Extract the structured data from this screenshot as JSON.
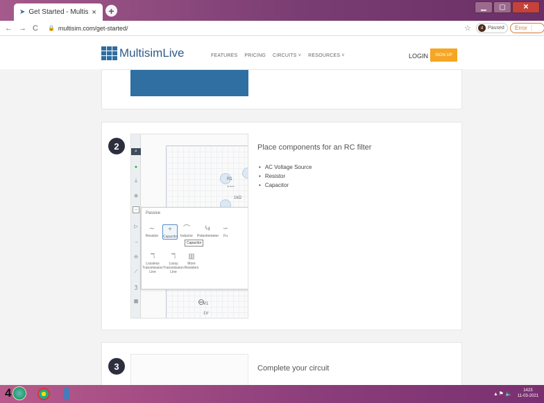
{
  "browser": {
    "tab_title": "Get Started - Multisim Liv",
    "tab_close": "×",
    "new_tab": "+",
    "nav_back": "←",
    "nav_forward": "→",
    "nav_reload": "C",
    "url": "multisim.com/get-started/",
    "profile_initial": "d",
    "profile_status": "Paused",
    "error_label": "Error"
  },
  "site": {
    "logo_text": "MultisimLive",
    "menu": [
      "FEATURES",
      "PRICING",
      "CIRCUITS ˅",
      "RESOURCES ˅"
    ],
    "login": "LOGIN",
    "signup": "SIGN UP"
  },
  "steps": [
    {
      "number": "2",
      "title": "Place components for an RC filter",
      "bullets": [
        "AC Voltage Source",
        "Resistor",
        "Capacitor"
      ]
    },
    {
      "number": "3",
      "title": "Complete your circuit"
    }
  ],
  "editor": {
    "r1_label": "R1",
    "r1_value": "1kΩ",
    "panel_title": "Passive",
    "tooltip": "Capacitor",
    "items": [
      "Resistor",
      "Capacitor",
      "Inductor",
      "Potentiometer",
      "Fu"
    ],
    "items2": [
      "Lossless Transmission Line",
      "Lossy Transmission Line",
      "More Resistors"
    ],
    "v1_label": "V1",
    "v1_value": "1V"
  },
  "taskbar": {
    "left_text": "4",
    "time": "1423",
    "date": "11-03-2021"
  }
}
